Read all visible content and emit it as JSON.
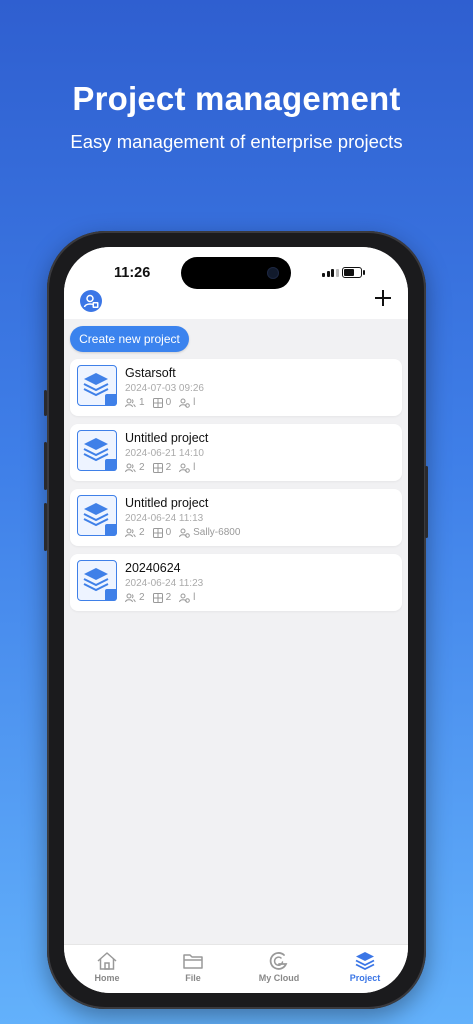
{
  "promo": {
    "title": "Project management",
    "subtitle": "Easy management of enterprise projects"
  },
  "status_bar": {
    "time": "11:26"
  },
  "header": {
    "avatar_icon": "user-avatar-icon",
    "add_icon": "plus-icon"
  },
  "actions": {
    "create_label": "Create new project"
  },
  "projects": [
    {
      "name": "Gstarsoft",
      "date": "2024-07-03 09:26",
      "members": "1",
      "files": "0",
      "owner": "l"
    },
    {
      "name": "Untitled project",
      "date": "2024-06-21 14:10",
      "members": "2",
      "files": "2",
      "owner": "l"
    },
    {
      "name": "Untitled project",
      "date": "2024-06-24 11:13",
      "members": "2",
      "files": "0",
      "owner": "Sally-6800"
    },
    {
      "name": "20240624",
      "date": "2024-06-24 11:23",
      "members": "2",
      "files": "2",
      "owner": "l"
    }
  ],
  "tabs": [
    {
      "label": "Home",
      "icon": "home-icon"
    },
    {
      "label": "File",
      "icon": "folder-icon"
    },
    {
      "label": "My Cloud",
      "icon": "cloud-g-icon"
    },
    {
      "label": "Project",
      "icon": "layers-icon",
      "active": true
    }
  ],
  "colors": {
    "accent": "#3b76e6",
    "background_top": "#2f5fd0",
    "background_bottom": "#63b1fb"
  }
}
